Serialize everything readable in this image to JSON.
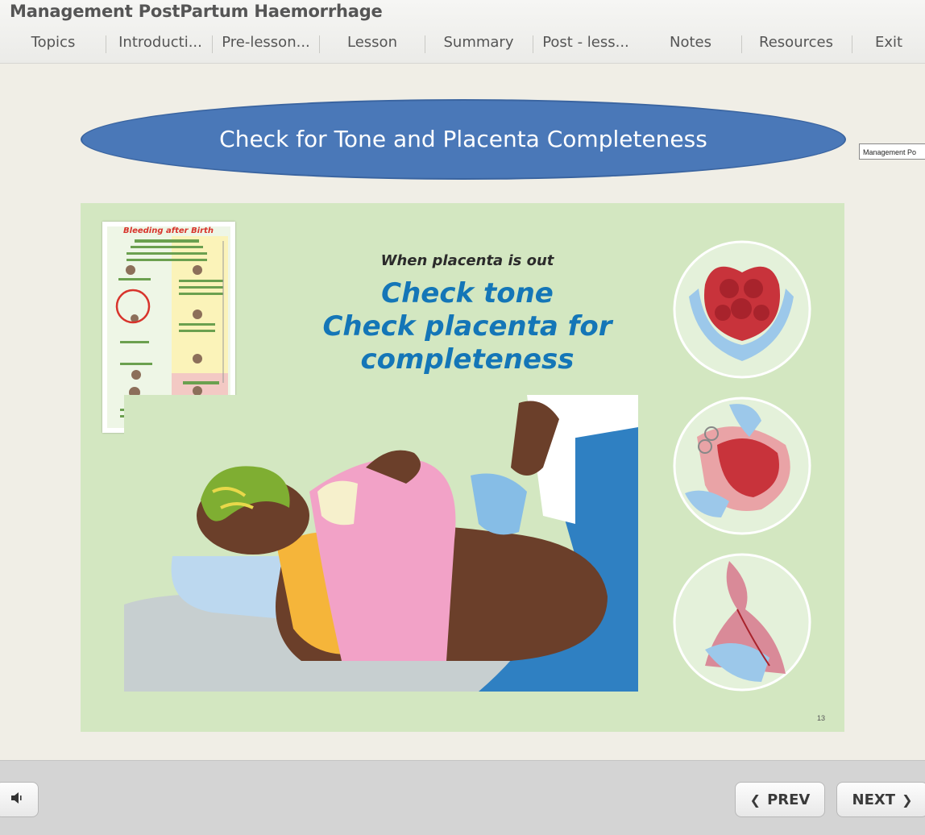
{
  "app": {
    "title": "Management PostPartum Haemorrhage"
  },
  "nav": [
    {
      "label": "Topics"
    },
    {
      "label": "Introducti..."
    },
    {
      "label": "Pre-lesson..."
    },
    {
      "label": "Lesson"
    },
    {
      "label": "Summary"
    },
    {
      "label": "Post - less..."
    },
    {
      "label": "Notes"
    },
    {
      "label": "Resources"
    },
    {
      "label": "Exit"
    }
  ],
  "slide": {
    "heading": "Check for Tone and Placenta Completeness",
    "tooltip": "Management Po",
    "subtitle": "When placenta is out",
    "line1": "Check tone",
    "line2": "Check placenta for",
    "line3": "completeness",
    "page_number": "13",
    "thumbnail_title": "Bleeding after Birth"
  },
  "footer": {
    "prev_label": "PREV",
    "next_label": "NEXT"
  },
  "icons": {
    "sound": "speaker-icon",
    "prev": "chevron-left-icon",
    "next": "chevron-right-icon"
  },
  "colors": {
    "ellipse": "#4a78b8",
    "slide_bg": "#d3e7c1",
    "accent_text": "#1476b7"
  }
}
